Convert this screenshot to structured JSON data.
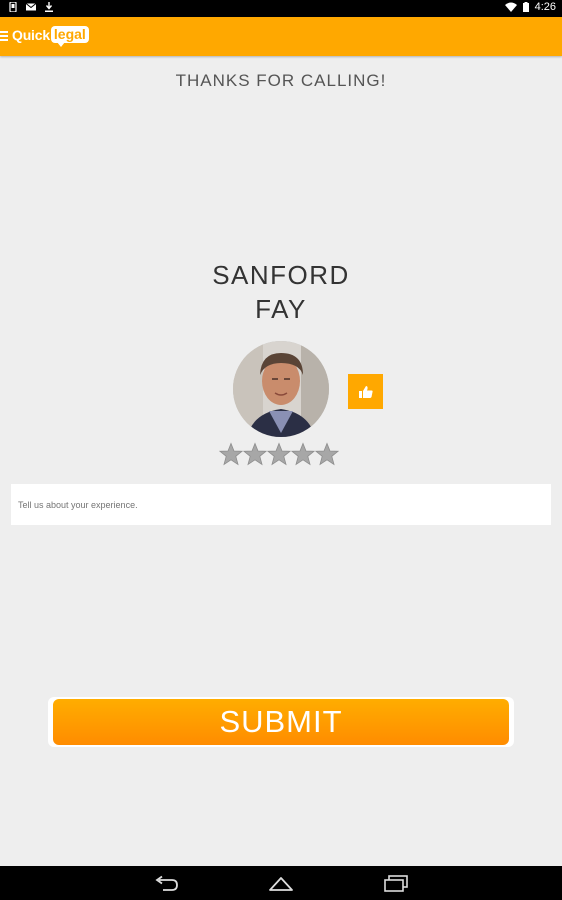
{
  "status_bar": {
    "time": "4:26",
    "icons": [
      "screenshot-icon",
      "gmail-icon",
      "download-icon",
      "wifi-icon",
      "battery-icon"
    ]
  },
  "app_bar": {
    "menu_icon": "hamburger-icon",
    "logo_part1": "Quick",
    "logo_part2": "legal",
    "color": "#ffa800"
  },
  "main": {
    "heading": "THANKS FOR CALLING!",
    "lawyer_first_name": "SANFORD",
    "lawyer_last_name": "FAY",
    "thumb_icon": "thumbs-up-icon",
    "rating": {
      "max": 5,
      "value": 0
    },
    "feedback_placeholder": "Tell us about your experience.",
    "submit_label": "SUBMIT"
  },
  "nav_bar": {
    "icons": [
      "back-icon",
      "home-icon",
      "recents-icon"
    ]
  }
}
